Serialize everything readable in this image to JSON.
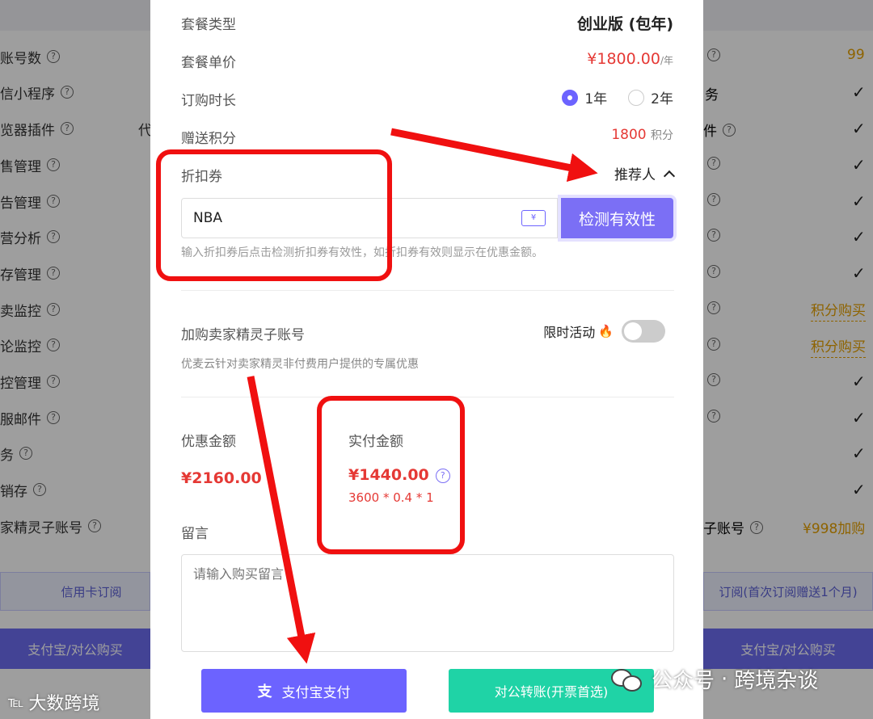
{
  "background": {
    "left_rows": [
      {
        "label": "账号数"
      },
      {
        "label": "信小程序"
      },
      {
        "label": "览器插件"
      },
      {
        "label": "售管理"
      },
      {
        "label": "告管理"
      },
      {
        "label": "营分析"
      },
      {
        "label": "存管理"
      },
      {
        "label": "卖监控"
      },
      {
        "label": "论监控"
      },
      {
        "label": "控管理"
      },
      {
        "label": "服邮件"
      },
      {
        "label": "务"
      },
      {
        "label": "销存"
      },
      {
        "label": "家精灵子账号"
      }
    ],
    "left_fragment": "代",
    "right_values": [
      "99",
      "✓",
      "✓",
      "✓",
      "✓",
      "✓",
      "✓",
      "积分购买",
      "积分购买",
      "✓",
      "✓",
      "✓",
      "✓",
      "¥998加购"
    ],
    "right_label_fragments": [
      "务",
      "件",
      "子账号"
    ],
    "credit_card_subscribe": "信用卡订阅",
    "subscribe_right": "订阅(首次订阅赠送1个月)",
    "alipay_left": "支付宝/对公购买",
    "alipay_right": "支付宝/对公购买"
  },
  "modal": {
    "plan_type_label": "套餐类型",
    "plan_type_value": "创业版 (包年)",
    "unit_price_label": "套餐单价",
    "unit_price_value": "¥1800.00",
    "unit_price_unit": "/年",
    "duration_label": "订购时长",
    "duration_options": [
      {
        "label": "1年",
        "selected": true
      },
      {
        "label": "2年",
        "selected": false
      }
    ],
    "bonus_label": "赠送积分",
    "bonus_value": "1800",
    "bonus_unit": "积分",
    "coupon_label": "折扣券",
    "referrer_label": "推荐人",
    "coupon_value": "NBA",
    "check_button": "检测有效性",
    "coupon_hint": "输入折扣券后点击检测折扣券有效性，如折扣券有效则显示在优惠金额。",
    "addon_label": "加购卖家精灵子账号",
    "limited_label": "限时活动",
    "addon_desc": "优麦云针对卖家精灵非付费用户提供的专属优惠",
    "discount_label": "优惠金额",
    "discount_value": "¥2160.00",
    "paid_label": "实付金额",
    "paid_value": "¥1440.00",
    "paid_formula": "3600 * 0.4 * 1",
    "message_label": "留言",
    "message_placeholder": "请输入购买留言",
    "alipay_button": "支付宝支付",
    "transfer_button": "对公转账(开票首选)"
  },
  "watermarks": {
    "left": "大数跨境",
    "right_a": "公众号",
    "right_b": "跨境杂谈"
  },
  "colors": {
    "accent": "#6c63ff",
    "price_red": "#e53935",
    "teal": "#1fd3a6",
    "annotation_red": "#f01010"
  }
}
